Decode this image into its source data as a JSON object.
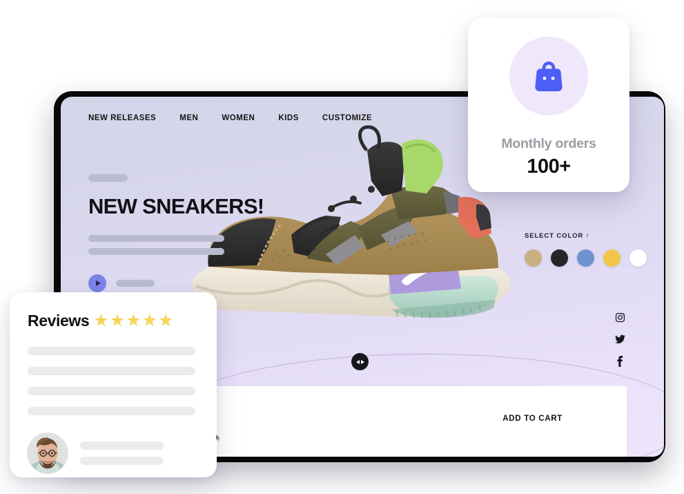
{
  "site": {
    "nav": [
      {
        "label": "NEW RELEASES",
        "name": "nav-new-releases"
      },
      {
        "label": "MEN",
        "name": "nav-men"
      },
      {
        "label": "WOMEN",
        "name": "nav-women"
      },
      {
        "label": "KIDS",
        "name": "nav-kids"
      },
      {
        "label": "CUSTOMIZE",
        "name": "nav-customize"
      }
    ],
    "hero": {
      "title": "NEW SNEAKERS!",
      "play_icon": "play-icon"
    },
    "color_picker": {
      "label": "SELECT COLOR ↑",
      "swatches": [
        {
          "name": "swatch-tan",
          "hex": "#c9b083"
        },
        {
          "name": "swatch-black",
          "hex": "#252527"
        },
        {
          "name": "swatch-blue",
          "hex": "#6d93d3"
        },
        {
          "name": "swatch-yellow",
          "hex": "#f3c649"
        },
        {
          "name": "swatch-white",
          "hex": "#ffffff"
        }
      ]
    },
    "social": [
      {
        "name": "instagram-icon",
        "label": "Instagram"
      },
      {
        "name": "twitter-icon",
        "label": "Twitter"
      },
      {
        "name": "facebook-icon",
        "label": "Facebook"
      }
    ],
    "carousel": {
      "name": "carousel-arrows-button",
      "icon": "left-right-arrows-icon"
    },
    "cart": {
      "label": "ADD TO CART"
    },
    "product": {
      "name": "sneaker-product-image",
      "alt": "Olive and tan high-top sneaker"
    }
  },
  "orders_card": {
    "icon": "shopping-bag-icon",
    "icon_color": "#4c5ef5",
    "circle_color": "#efe7fb",
    "title": "Monthly orders",
    "value": "100+"
  },
  "reviews_card": {
    "title": "Reviews",
    "rating": 5,
    "star_glyph": "★",
    "star_color": "#f7d45c",
    "avatar_name": "reviewer-avatar"
  },
  "theme": {
    "bg_top": "#d3d5e9",
    "bg_bottom": "#eee5fc",
    "frame": "#080808",
    "accent": "#7b83e8",
    "skeleton": "#b9bcd0",
    "skeleton_light": "#ebebed"
  }
}
